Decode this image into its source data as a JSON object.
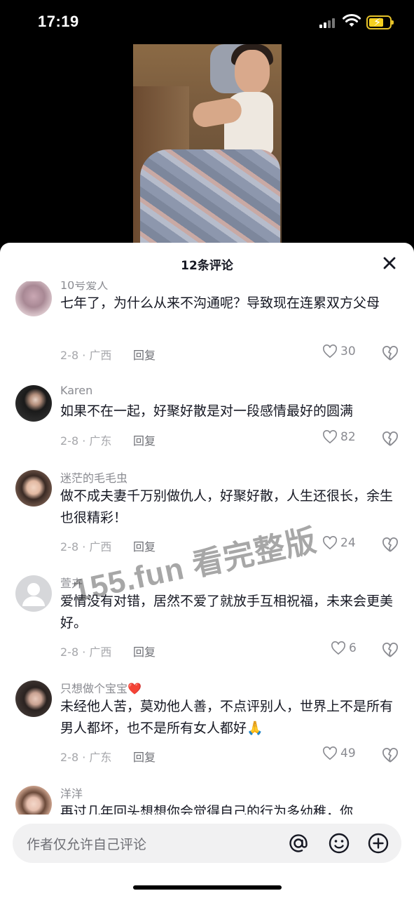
{
  "status_bar": {
    "time": "17:19"
  },
  "sheet": {
    "title": "12条评论"
  },
  "comments": [
    {
      "user": "10号爱人",
      "text": "七年了，为什么从来不沟通呢？导致现在连累双方父母",
      "date_location": "2-8 · 广西",
      "reply_label": "回复",
      "likes": "30"
    },
    {
      "user": "Karen",
      "text": "如果不在一起，好聚好散是对一段感情最好的圆满",
      "date_location": "2-8 · 广东",
      "reply_label": "回复",
      "likes": "82"
    },
    {
      "user": "迷茫的毛毛虫",
      "text": "做不成夫妻千万别做仇人，好聚好散，人生还很长，余生也很精彩！",
      "date_location": "2-8 · 广西",
      "reply_label": "回复",
      "likes": "24"
    },
    {
      "user": "萱卉",
      "text": "爱情没有对错，居然不爱了就放手互相祝福，未来会更美好。",
      "date_location": "2-8 · 广西",
      "reply_label": "回复",
      "likes": "6"
    },
    {
      "user": "只想做个宝宝❤️",
      "text": "未经他人苦，莫劝他人善，不点评别人，世界上不是所有男人都坏，也不是所有女人都好🙏",
      "date_location": "2-8 · 广东",
      "reply_label": "回复",
      "likes": "49"
    },
    {
      "user": "洋洋",
      "text": "再过几年回头想想你会觉得自己的行为多幼稚，你"
    }
  ],
  "watermark": "155.fun 看完整版",
  "input": {
    "placeholder": "作者仅允许自己评论"
  },
  "colors": {
    "heart_outline": "#8a8b91",
    "watermark": "#3c3c3c"
  }
}
